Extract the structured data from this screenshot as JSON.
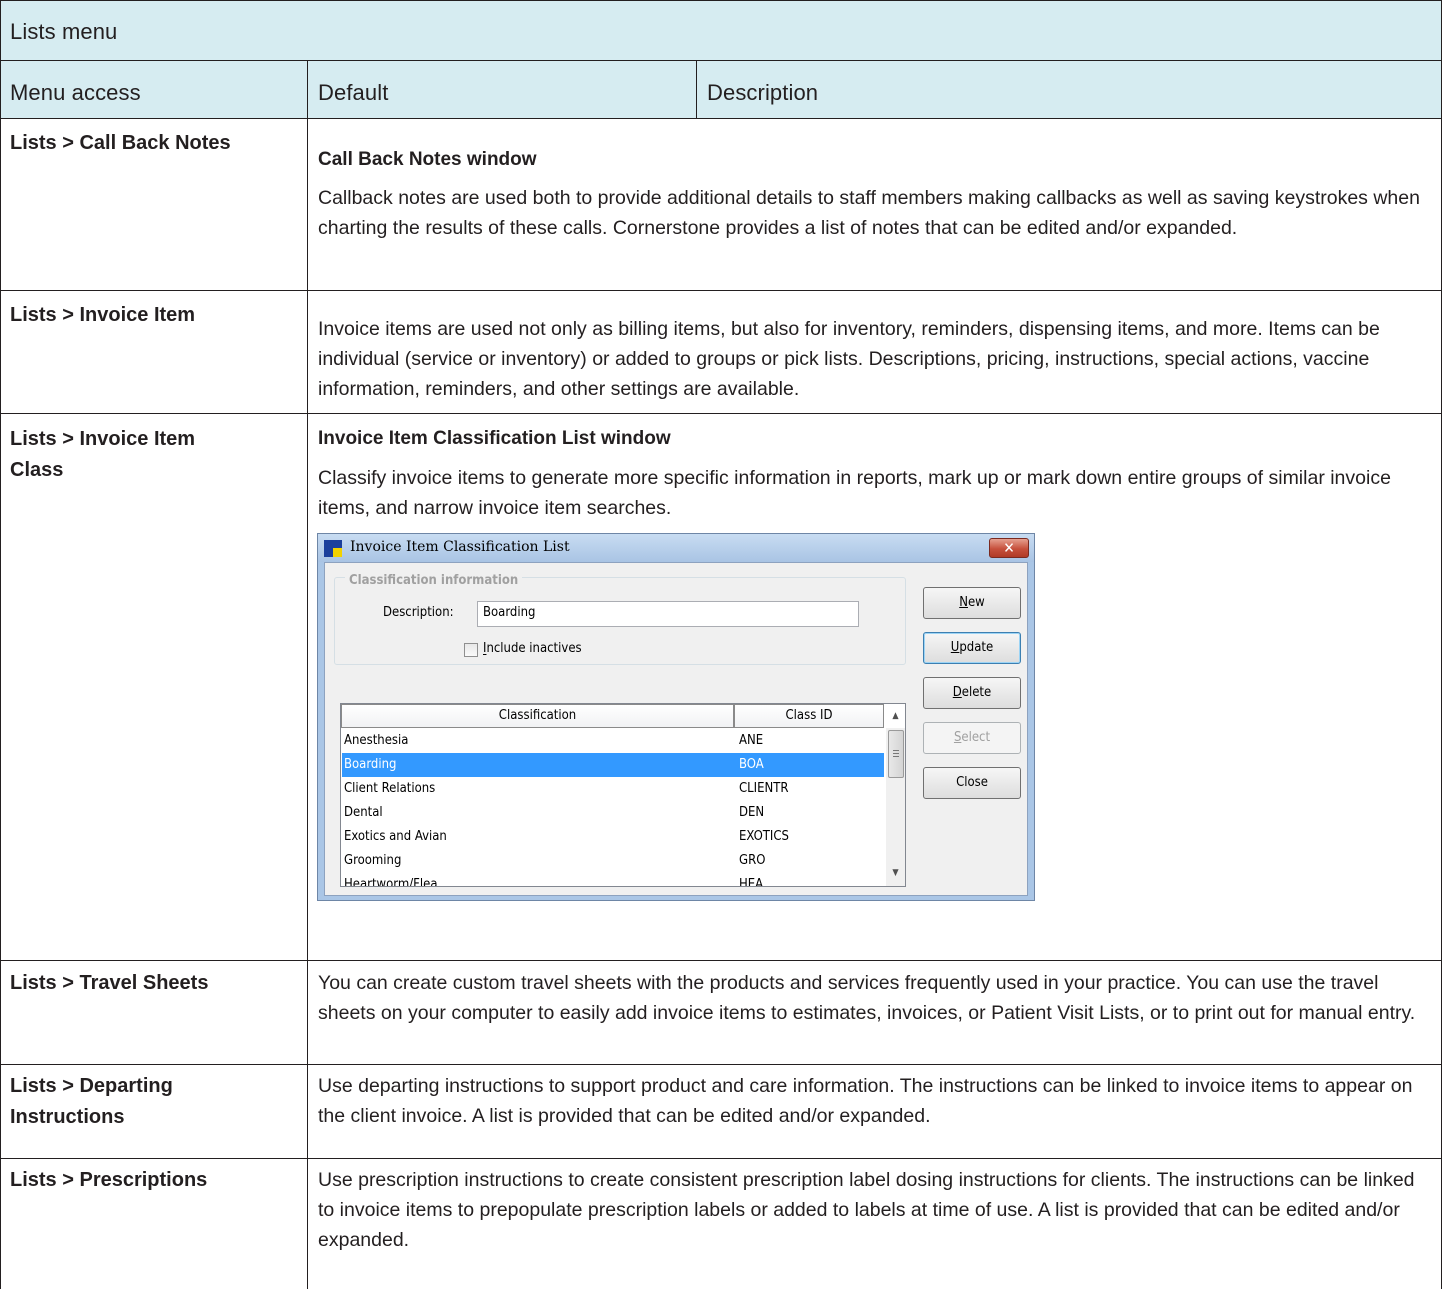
{
  "table": {
    "title": "Lists menu",
    "headers": [
      "Menu access",
      "Default",
      "Description"
    ],
    "rows": [
      {
        "menu": "Lists > Call Back Notes",
        "subheading": "Call Back Notes window",
        "body": "Callback notes are used both to provide additional details to staff members making callbacks as well as saving keystrokes when charting the results of these calls. Cornerstone provides a list of notes that can be edited and/or expanded."
      },
      {
        "menu": "Lists > Invoice Item",
        "body": "Invoice items are used not only as billing items, but also for inventory, reminders, dispensing items, and more. Items can be individual (service or inventory) or added to groups or pick lists. Descriptions, pricing, instructions, special actions, vaccine information, reminders, and other settings are available."
      },
      {
        "menu_line1": "Lists > Invoice Item",
        "menu_line2": "Class",
        "subheading": "Invoice Item Classification List window",
        "body": "Classify invoice items to generate more specific information in reports, mark up or mark down entire groups of similar invoice items, and narrow invoice item searches."
      },
      {
        "menu": "Lists > Travel Sheets",
        "body": "You can create custom travel sheets with the products and services frequently used in your practice. You can use the travel sheets on your computer to easily add invoice items to estimates, invoices, or Patient Visit Lists, or to print out for manual entry."
      },
      {
        "menu_line1": "Lists > Departing",
        "menu_line2": "Instructions",
        "body": "Use departing instructions to support product and care information. The instructions can be linked to invoice items to appear on the client invoice. A list is provided that can be edited and/or expanded."
      },
      {
        "menu": "Lists > Prescriptions",
        "body": "Use prescription instructions to create consistent prescription label dosing instructions for clients. The instructions can be linked to invoice items to prepopulate prescription labels or added to labels at time of use. A list is provided that can be edited and/or expanded."
      }
    ]
  },
  "dialog": {
    "title": "Invoice Item Classification List",
    "close_glyph": "✕",
    "group_label": "Classification information",
    "description_label": "Description:",
    "description_value": "Boarding",
    "include_inactives_label": "Include inactives",
    "include_inactives_checked": false,
    "buttons": {
      "new": "New",
      "update": "Update",
      "delete": "Delete",
      "select": "Select",
      "close": "Close"
    },
    "list_headers": [
      "Classification",
      "Class ID"
    ],
    "list_rows": [
      {
        "classification": "Anesthesia",
        "class_id": "ANE"
      },
      {
        "classification": "Boarding",
        "class_id": "BOA",
        "selected": true
      },
      {
        "classification": "Client Relations",
        "class_id": "CLIENTR"
      },
      {
        "classification": "Dental",
        "class_id": "DEN"
      },
      {
        "classification": "Exotics and Avian",
        "class_id": "EXOTICS"
      },
      {
        "classification": "Grooming",
        "class_id": "GRO"
      },
      {
        "classification": "Heartworm/Flea",
        "class_id": "HEA"
      }
    ],
    "colors": {
      "selection": "#3399ff",
      "titlebar": "#aac6e6",
      "close_button": "#c6503c"
    },
    "icons": [
      "app-icon",
      "close-icon",
      "scroll-up-icon",
      "scroll-down-icon",
      "checkbox-icon"
    ]
  },
  "colors": {
    "header_fill": "#d6ecf1",
    "rule": "#231f20"
  }
}
